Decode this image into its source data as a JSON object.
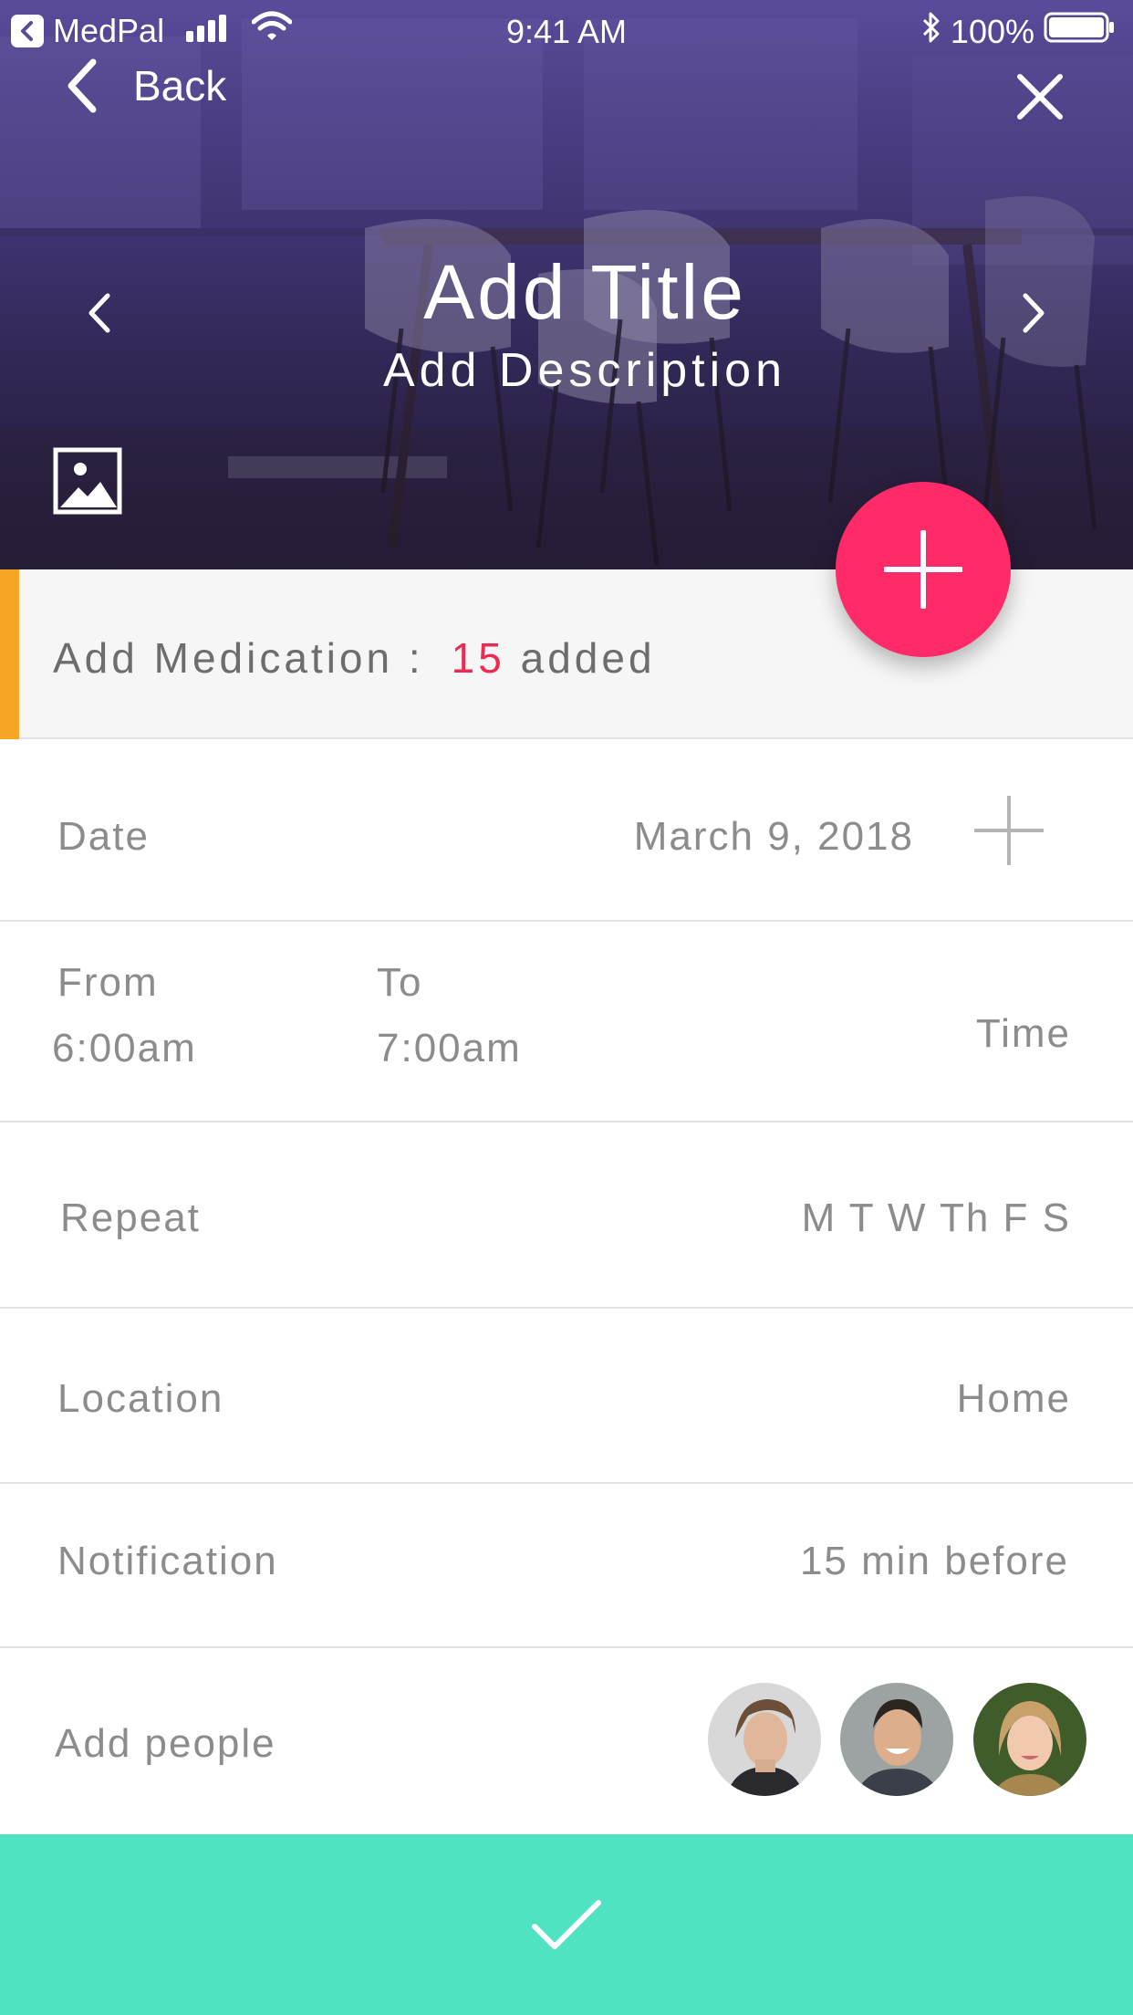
{
  "status_bar": {
    "app_name": "MedPal",
    "time": "9:41 AM",
    "battery": "100%"
  },
  "nav": {
    "back_label": "Back"
  },
  "hero": {
    "title": "Add Title",
    "description": "Add Description"
  },
  "medication": {
    "label": "Add Medication :",
    "count": "15",
    "suffix": "added"
  },
  "date_row": {
    "label": "Date",
    "value": "March 9, 2018"
  },
  "time_row": {
    "from_label": "From",
    "from_value": "6:00am",
    "to_label": "To",
    "to_value": "7:00am",
    "label": "Time"
  },
  "repeat_row": {
    "label": "Repeat",
    "value": "M T W Th F S"
  },
  "location_row": {
    "label": "Location",
    "value": "Home"
  },
  "notification_row": {
    "label": "Notification",
    "value": "15 min before"
  },
  "people_row": {
    "label": "Add people"
  },
  "colors": {
    "fab": "#ff2a67",
    "accent_bar": "#f6a623",
    "count": "#ee2a52",
    "confirm": "#50e3c2",
    "hero_overlay": "#4b3d83"
  },
  "icons": [
    "app-back-icon",
    "signal-icon",
    "wifi-icon",
    "bluetooth-icon",
    "battery-icon",
    "back-chevron-icon",
    "close-icon",
    "chevron-left-icon",
    "chevron-right-icon",
    "image-icon",
    "plus-icon",
    "checkmark-icon"
  ]
}
